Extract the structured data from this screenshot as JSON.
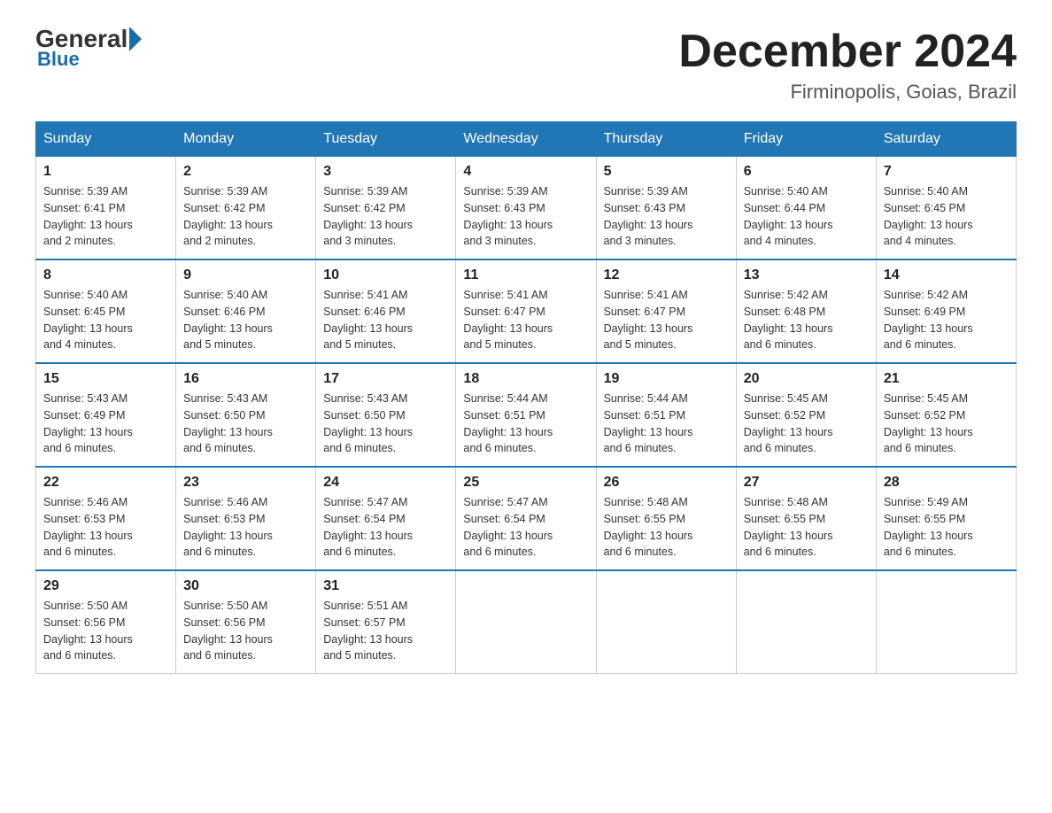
{
  "header": {
    "logo": {
      "general": "General",
      "blue": "Blue"
    },
    "title": "December 2024",
    "location": "Firminopolis, Goias, Brazil"
  },
  "weekdays": [
    "Sunday",
    "Monday",
    "Tuesday",
    "Wednesday",
    "Thursday",
    "Friday",
    "Saturday"
  ],
  "weeks": [
    [
      {
        "day": "1",
        "sunrise": "5:39 AM",
        "sunset": "6:41 PM",
        "daylight": "13 hours and 2 minutes."
      },
      {
        "day": "2",
        "sunrise": "5:39 AM",
        "sunset": "6:42 PM",
        "daylight": "13 hours and 2 minutes."
      },
      {
        "day": "3",
        "sunrise": "5:39 AM",
        "sunset": "6:42 PM",
        "daylight": "13 hours and 3 minutes."
      },
      {
        "day": "4",
        "sunrise": "5:39 AM",
        "sunset": "6:43 PM",
        "daylight": "13 hours and 3 minutes."
      },
      {
        "day": "5",
        "sunrise": "5:39 AM",
        "sunset": "6:43 PM",
        "daylight": "13 hours and 3 minutes."
      },
      {
        "day": "6",
        "sunrise": "5:40 AM",
        "sunset": "6:44 PM",
        "daylight": "13 hours and 4 minutes."
      },
      {
        "day": "7",
        "sunrise": "5:40 AM",
        "sunset": "6:45 PM",
        "daylight": "13 hours and 4 minutes."
      }
    ],
    [
      {
        "day": "8",
        "sunrise": "5:40 AM",
        "sunset": "6:45 PM",
        "daylight": "13 hours and 4 minutes."
      },
      {
        "day": "9",
        "sunrise": "5:40 AM",
        "sunset": "6:46 PM",
        "daylight": "13 hours and 5 minutes."
      },
      {
        "day": "10",
        "sunrise": "5:41 AM",
        "sunset": "6:46 PM",
        "daylight": "13 hours and 5 minutes."
      },
      {
        "day": "11",
        "sunrise": "5:41 AM",
        "sunset": "6:47 PM",
        "daylight": "13 hours and 5 minutes."
      },
      {
        "day": "12",
        "sunrise": "5:41 AM",
        "sunset": "6:47 PM",
        "daylight": "13 hours and 5 minutes."
      },
      {
        "day": "13",
        "sunrise": "5:42 AM",
        "sunset": "6:48 PM",
        "daylight": "13 hours and 6 minutes."
      },
      {
        "day": "14",
        "sunrise": "5:42 AM",
        "sunset": "6:49 PM",
        "daylight": "13 hours and 6 minutes."
      }
    ],
    [
      {
        "day": "15",
        "sunrise": "5:43 AM",
        "sunset": "6:49 PM",
        "daylight": "13 hours and 6 minutes."
      },
      {
        "day": "16",
        "sunrise": "5:43 AM",
        "sunset": "6:50 PM",
        "daylight": "13 hours and 6 minutes."
      },
      {
        "day": "17",
        "sunrise": "5:43 AM",
        "sunset": "6:50 PM",
        "daylight": "13 hours and 6 minutes."
      },
      {
        "day": "18",
        "sunrise": "5:44 AM",
        "sunset": "6:51 PM",
        "daylight": "13 hours and 6 minutes."
      },
      {
        "day": "19",
        "sunrise": "5:44 AM",
        "sunset": "6:51 PM",
        "daylight": "13 hours and 6 minutes."
      },
      {
        "day": "20",
        "sunrise": "5:45 AM",
        "sunset": "6:52 PM",
        "daylight": "13 hours and 6 minutes."
      },
      {
        "day": "21",
        "sunrise": "5:45 AM",
        "sunset": "6:52 PM",
        "daylight": "13 hours and 6 minutes."
      }
    ],
    [
      {
        "day": "22",
        "sunrise": "5:46 AM",
        "sunset": "6:53 PM",
        "daylight": "13 hours and 6 minutes."
      },
      {
        "day": "23",
        "sunrise": "5:46 AM",
        "sunset": "6:53 PM",
        "daylight": "13 hours and 6 minutes."
      },
      {
        "day": "24",
        "sunrise": "5:47 AM",
        "sunset": "6:54 PM",
        "daylight": "13 hours and 6 minutes."
      },
      {
        "day": "25",
        "sunrise": "5:47 AM",
        "sunset": "6:54 PM",
        "daylight": "13 hours and 6 minutes."
      },
      {
        "day": "26",
        "sunrise": "5:48 AM",
        "sunset": "6:55 PM",
        "daylight": "13 hours and 6 minutes."
      },
      {
        "day": "27",
        "sunrise": "5:48 AM",
        "sunset": "6:55 PM",
        "daylight": "13 hours and 6 minutes."
      },
      {
        "day": "28",
        "sunrise": "5:49 AM",
        "sunset": "6:55 PM",
        "daylight": "13 hours and 6 minutes."
      }
    ],
    [
      {
        "day": "29",
        "sunrise": "5:50 AM",
        "sunset": "6:56 PM",
        "daylight": "13 hours and 6 minutes."
      },
      {
        "day": "30",
        "sunrise": "5:50 AM",
        "sunset": "6:56 PM",
        "daylight": "13 hours and 6 minutes."
      },
      {
        "day": "31",
        "sunrise": "5:51 AM",
        "sunset": "6:57 PM",
        "daylight": "13 hours and 5 minutes."
      },
      null,
      null,
      null,
      null
    ]
  ],
  "labels": {
    "sunrise": "Sunrise:",
    "sunset": "Sunset:",
    "daylight": "Daylight:"
  }
}
